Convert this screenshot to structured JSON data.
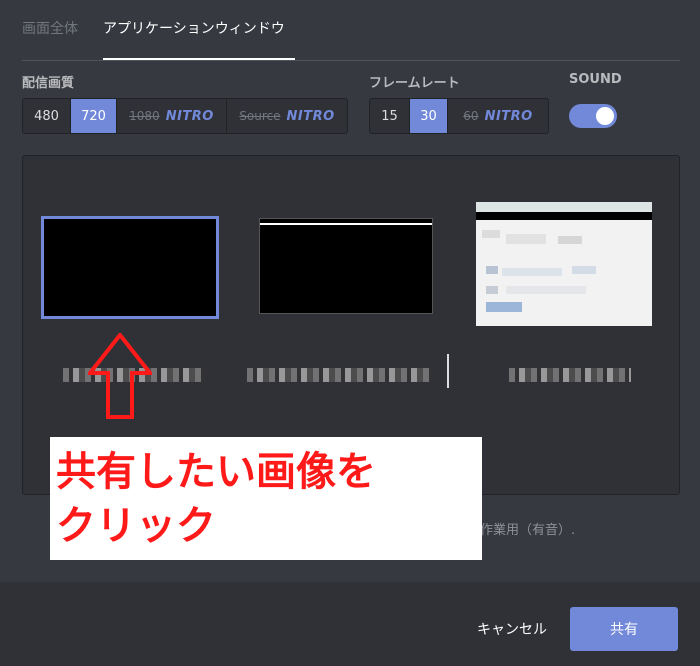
{
  "tabs": [
    {
      "label": "画面全体",
      "active": false
    },
    {
      "label": "アプリケーションウィンドウ",
      "active": true
    }
  ],
  "resolution": {
    "label": "配信画質",
    "options": [
      {
        "label": "480",
        "active": true
      },
      {
        "label": "720",
        "active": true
      },
      {
        "label": "1080",
        "locked": true,
        "badge": "NITRO"
      },
      {
        "label": "Source",
        "locked": true,
        "badge": "NITRO"
      }
    ]
  },
  "framerate": {
    "label": "フレームレート",
    "options": [
      {
        "label": "15"
      },
      {
        "label": "30",
        "active": true
      },
      {
        "label": "60",
        "locked": true,
        "badge": "NITRO"
      }
    ]
  },
  "sound": {
    "label": "SOUND",
    "enabled": true
  },
  "note": "作業用（有音）.",
  "footer": {
    "cancel_label": "キャンセル",
    "share_label": "共有"
  },
  "annotation": {
    "text": "共有したい画像を\nクリック"
  },
  "colors": {
    "accent": "#7289da",
    "background": "#36393f",
    "annotation": "#ff1a1a"
  }
}
